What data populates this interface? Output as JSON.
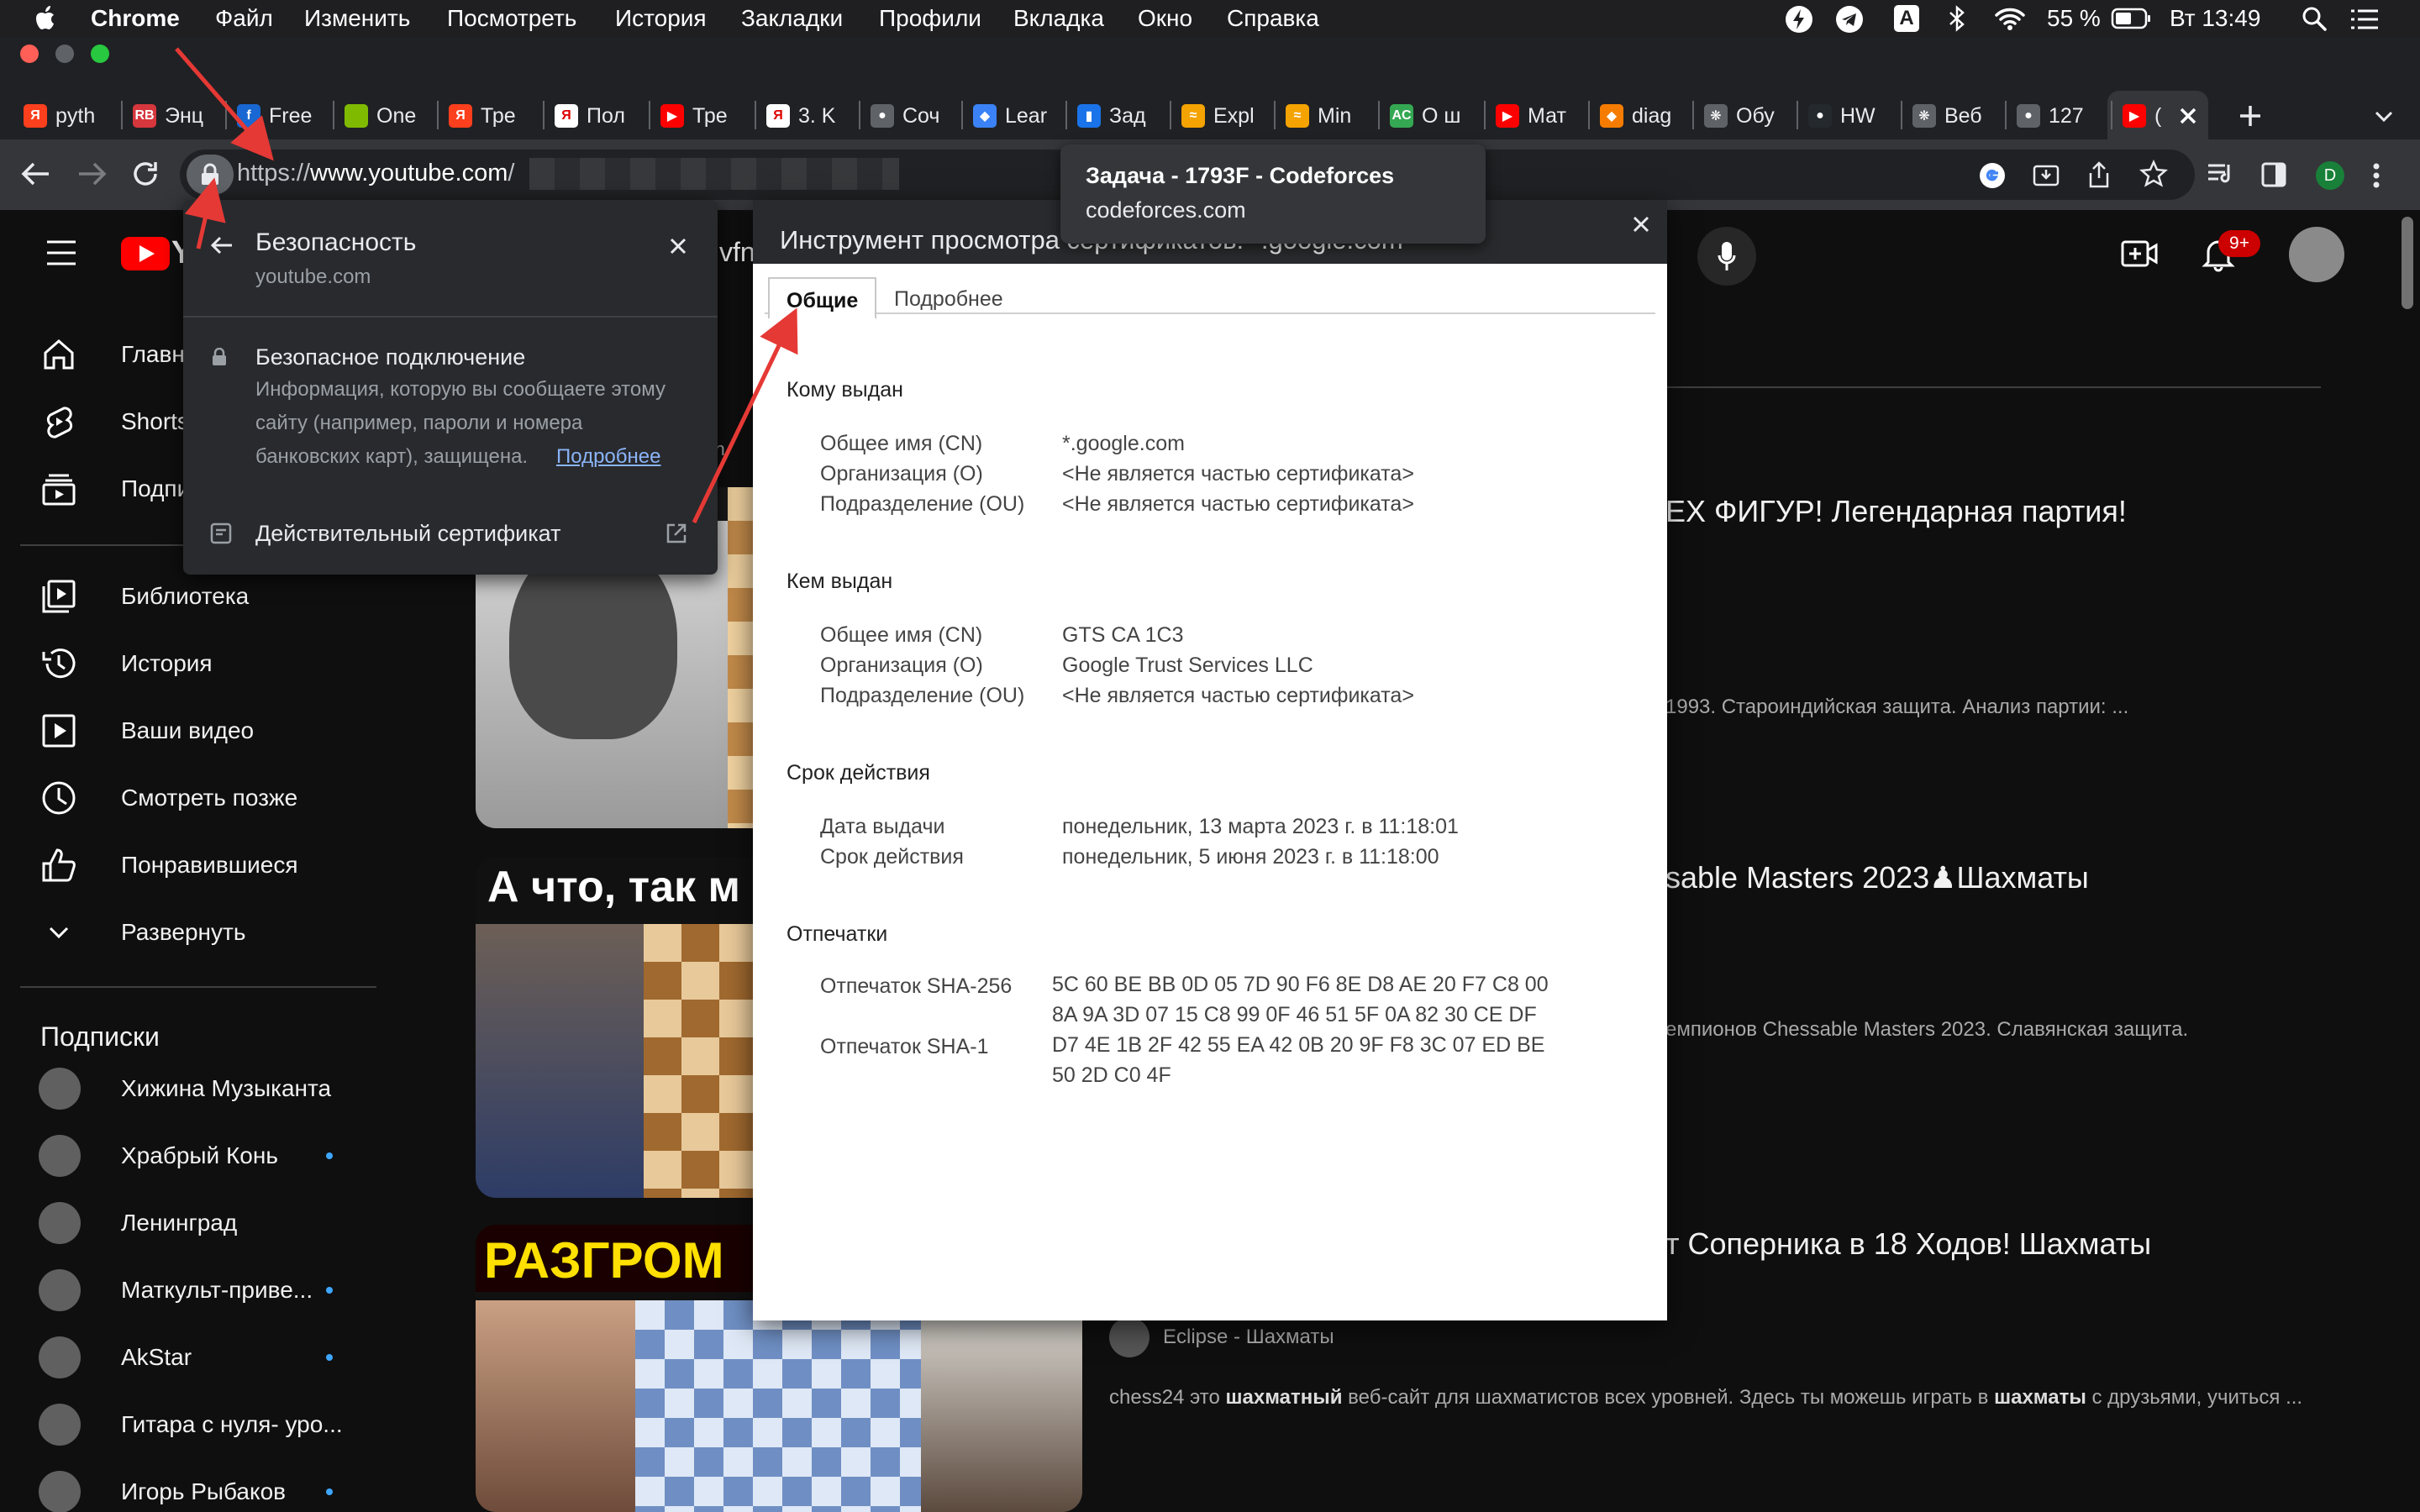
{
  "menubar": {
    "app": "Chrome",
    "items": [
      "Файл",
      "Изменить",
      "Посмотреть",
      "История",
      "Закладки",
      "Профили",
      "Вкладка",
      "Окно",
      "Справка"
    ],
    "battery": "55 %",
    "clock": "Вт 13:49",
    "input_letter": "A"
  },
  "tabs": [
    {
      "label": "pyth",
      "fav": "Я",
      "color": "#fc3f1d"
    },
    {
      "label": "Энц",
      "fav": "RB",
      "color": "#d6373d"
    },
    {
      "label": "Free",
      "fav": "f",
      "color": "#1967d2"
    },
    {
      "label": "One",
      "fav": "",
      "color": "#7fba00"
    },
    {
      "label": "Тре",
      "fav": "Я",
      "color": "#fc3f1d"
    },
    {
      "label": "Пол",
      "fav": "Я",
      "color": "#ffffff"
    },
    {
      "label": "Тре",
      "fav": "▶",
      "color": "#ff0000"
    },
    {
      "label": "3. K",
      "fav": "Я",
      "color": "#ffffff"
    },
    {
      "label": "Соч",
      "fav": "●",
      "color": "#5f6368"
    },
    {
      "label": "Lear",
      "fav": "◆",
      "color": "#3b82f6"
    },
    {
      "label": "Зад",
      "fav": "▮",
      "color": "#1a73e8"
    },
    {
      "label": "Expl",
      "fav": "≈",
      "color": "#f4a300"
    },
    {
      "label": "Min",
      "fav": "≈",
      "color": "#f4a300"
    },
    {
      "label": "О ш",
      "fav": "AC",
      "color": "#34a853"
    },
    {
      "label": "Мат",
      "fav": "▶",
      "color": "#ff0000"
    },
    {
      "label": "diag",
      "fav": "◆",
      "color": "#f57c00"
    },
    {
      "label": "Обу",
      "fav": "❋",
      "color": "#5f6368"
    },
    {
      "label": "HW",
      "fav": "●",
      "color": "#24292e"
    },
    {
      "label": "Веб",
      "fav": "❋",
      "color": "#5f6368"
    },
    {
      "label": "127",
      "fav": "●",
      "color": "#5f6368"
    },
    {
      "label": "(",
      "fav": "▶",
      "color": "#ff0000"
    }
  ],
  "omnibox": {
    "scheme": "https://",
    "domain": "www.youtube.com",
    "path": "/"
  },
  "tooltip": {
    "title": "Задача - 1793F - Codeforces",
    "host": "codeforces.com"
  },
  "security_popup": {
    "title": "Безопасность",
    "host": "youtube.com",
    "conn_title": "Безопасное подключение",
    "conn_line1": "Информация, которую вы сообщаете этому",
    "conn_line2": "сайту (например, пароли и номера",
    "conn_line3": "банковских карт), защищена.",
    "more_link": "Подробнее",
    "certificate": "Действительный сертификат"
  },
  "youtube": {
    "logo_letter": "Y",
    "search_fragment": "vfn",
    "notif_badge": "9+",
    "nav": [
      "Главн",
      "Shorts",
      "Подпи"
    ],
    "nav2": [
      "Библиотека",
      "История",
      "Ваши видео",
      "Смотреть позже",
      "Понравившиеся",
      "Развернуть"
    ],
    "subs_title": "Подписки",
    "subs": [
      "Хижина Музыканта",
      "Храбрый Конь",
      "Ленинград",
      "Маткульт-приве...",
      "AkStar",
      "Гитара с нуля- уро...",
      "Игорь Рыбаков"
    ],
    "sub_dots": [
      false,
      true,
      false,
      true,
      true,
      false,
      true
    ],
    "partial_text": "ean"
  },
  "videos": [
    {
      "title": "ЕХ ФИГУР! Легендарная партия!",
      "desc": "1993. Староиндийская защита. Анализ партии: ..."
    },
    {
      "title": "sable Masters 2023♟Шахматы",
      "desc": "емпионов Chessable Masters 2023. Славянская защита.",
      "thumb_text": "А что, так м"
    },
    {
      "title": "т Соперника в 18 Ходов! Шахматы",
      "channel": "Eclipse - Шахматы",
      "desc_a": "chess24 это ",
      "desc_b": "шахматный",
      "desc_c": " веб-сайт для шахматистов всех уровней. Здесь ты можешь играть в ",
      "desc_d": "шахматы",
      "desc_e": " с друзьями, учиться ...",
      "thumb_text": "РАЗГРОМ"
    }
  ],
  "certificate": {
    "window_title": "Инструмент просмотра сертификатов: *.google.com",
    "tab_general": "Общие",
    "tab_details": "Подробнее",
    "issued_to_h": "Кому выдан",
    "issued_to": [
      {
        "k": "Общее имя (CN)",
        "v": "*.google.com"
      },
      {
        "k": "Организация (O)",
        "v": "<Не является частью сертификата>"
      },
      {
        "k": "Подразделение (OU)",
        "v": "<Не является частью сертификата>"
      }
    ],
    "issued_by_h": "Кем выдан",
    "issued_by": [
      {
        "k": "Общее имя (CN)",
        "v": "GTS CA 1C3"
      },
      {
        "k": "Организация (O)",
        "v": "Google Trust Services LLC"
      },
      {
        "k": "Подразделение (OU)",
        "v": "<Не является частью сертификата>"
      }
    ],
    "validity_h": "Срок действия",
    "validity": [
      {
        "k": "Дата выдачи",
        "v": "понедельник, 13 марта 2023 г. в 11:18:01"
      },
      {
        "k": "Срок действия",
        "v": "понедельник, 5 июня 2023 г. в 11:18:00"
      }
    ],
    "fingerprints_h": "Отпечатки",
    "sha256_k": "Отпечаток SHA-256",
    "sha256_l1": "5C 60 BE BB 0D 05 7D 90 F6 8E D8 AE 20 F7 C8 00",
    "sha256_l2": "8A 9A 3D 07 15 C8 99 0F 46 51 5F 0A 82 30 CE DF",
    "sha1_k": "Отпечаток SHA-1",
    "sha1_l1": "D7 4E 1B 2F 42 55 EA 42 0B 20 9F F8 3C 07 ED BE",
    "sha1_l2": "50 2D C0 4F"
  },
  "colors": {
    "accent_red": "#e53935",
    "link_blue": "#8ab4f8",
    "yt_red": "#ff0000"
  }
}
